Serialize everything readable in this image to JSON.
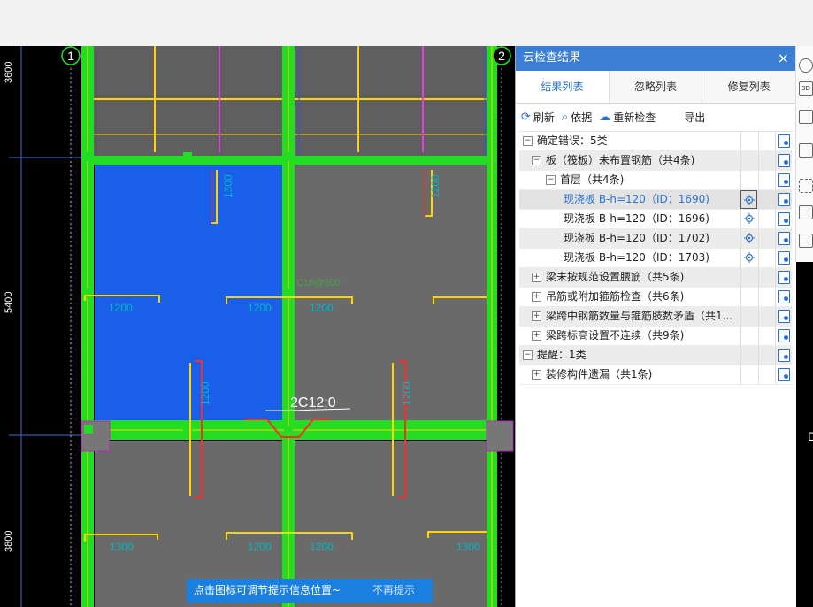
{
  "cad": {
    "axis_labels": [
      "1",
      "2"
    ],
    "dim_labels": [
      "3600",
      "5400",
      "3800"
    ],
    "rebar_labels": [
      "1300",
      "1200",
      "1200",
      "1200",
      "1200",
      "1200",
      "1200",
      "1300",
      "1200",
      "1200",
      "1300"
    ],
    "annotation": "2C12;0",
    "faint_label": "C10@200",
    "right_axis": "D"
  },
  "panel": {
    "title": "云检查结果",
    "close": "×",
    "tabs": [
      "结果列表",
      "忽略列表",
      "修复列表"
    ],
    "active_tab": "结果列表",
    "toolbar": {
      "refresh": "刷新",
      "basis": "依据",
      "recheck": "重新检查",
      "export": "导出"
    },
    "toolbar_icons": {
      "refresh": "refresh-icon",
      "basis": "magnify-doc-icon",
      "recheck": "cloud-icon"
    }
  },
  "tree": [
    {
      "label": "确定错误：5类",
      "level": 0,
      "toggle": "−"
    },
    {
      "label": "板（筏板）未布置钢筋（共4条)",
      "level": 1,
      "toggle": "−"
    },
    {
      "label": "首层（共4条)",
      "level": 2,
      "toggle": "−"
    },
    {
      "label": "现浇板 B-h=120（ID：1690)",
      "level": 3,
      "toggle": "",
      "locate": true,
      "selected": true
    },
    {
      "label": "现浇板 B-h=120（ID：1696)",
      "level": 3,
      "toggle": "",
      "locate": true
    },
    {
      "label": "现浇板 B-h=120（ID：1702)",
      "level": 3,
      "toggle": "",
      "locate": true
    },
    {
      "label": "现浇板 B-h=120（ID：1703)",
      "level": 3,
      "toggle": "",
      "locate": true
    },
    {
      "label": "梁未按规范设置腰筋（共5条)",
      "level": 1,
      "toggle": "+"
    },
    {
      "label": "吊筋或附加箍筋检查（共6条)",
      "level": 1,
      "toggle": "+"
    },
    {
      "label": "梁跨中钢筋数量与箍筋肢数矛盾（共1...",
      "level": 1,
      "toggle": "+"
    },
    {
      "label": "梁跨标高设置不连续（共9条)",
      "level": 1,
      "toggle": "+"
    },
    {
      "label": "提醒：1类",
      "level": 0,
      "toggle": "−"
    },
    {
      "label": "装修构件遗漏（共1条)",
      "level": 1,
      "toggle": "+"
    }
  ],
  "right_tools": [
    "3D"
  ],
  "hint": {
    "text": "点击图标可调节提示信息位置~",
    "dismiss": "不再提示"
  },
  "colors": {
    "accent": "#3a7fd5",
    "beam": "#22dd22",
    "slab": "#6a6a6a",
    "selected_slab": "#1a5fe8",
    "rebar": "#ff2a2a",
    "rebar_hook": "#ffd400",
    "cad_text": "#00b8c8"
  }
}
